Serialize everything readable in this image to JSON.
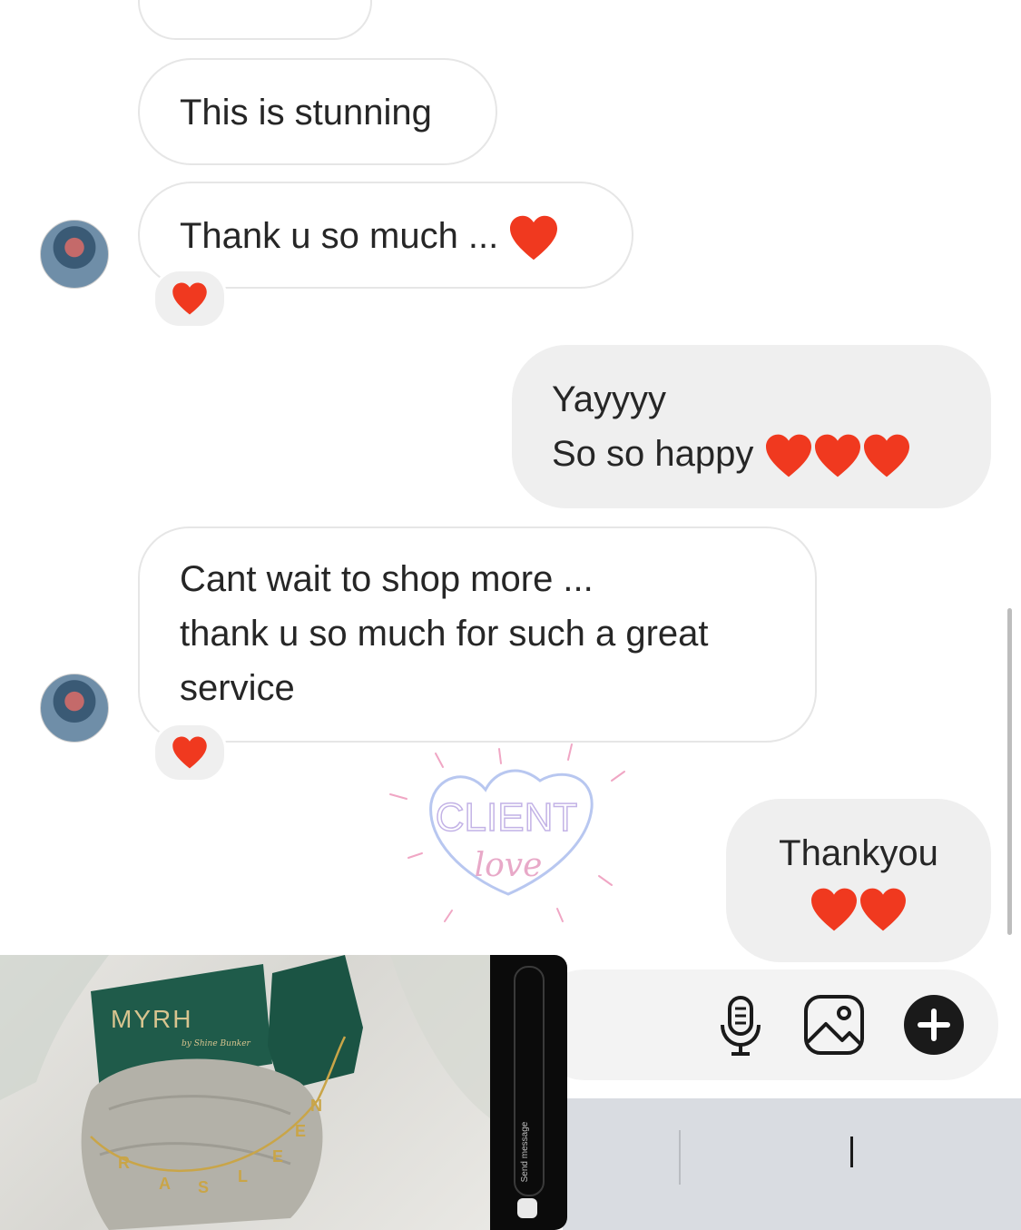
{
  "messages": {
    "m1": {
      "text": "This is stunning"
    },
    "m2": {
      "text": "Thank u so much ..."
    },
    "m3": {
      "line1": "Yayyyy",
      "line2": "So so happy"
    },
    "m4": {
      "line1": "Cant wait to shop more ...",
      "line2": "thank u so much for such a great",
      "line3": "service"
    },
    "m5": {
      "text": "Thankyou"
    }
  },
  "sticker": {
    "line1": "CLIENT",
    "line2": "love"
  },
  "story": {
    "brand": "MYRH",
    "brand_sub": "by Shine Bunker",
    "send_label": "Send message",
    "necklace_letters": [
      "R",
      "A",
      "S",
      "L",
      "E",
      "E",
      "N"
    ]
  },
  "colors": {
    "heart": "#f0391f",
    "bubble_out": "#efefef",
    "sticker_outline": "#b8c7f0",
    "sticker_text": "#e8a9c8"
  },
  "icons": [
    "heart-icon",
    "microphone-icon",
    "gallery-icon",
    "plus-icon"
  ]
}
